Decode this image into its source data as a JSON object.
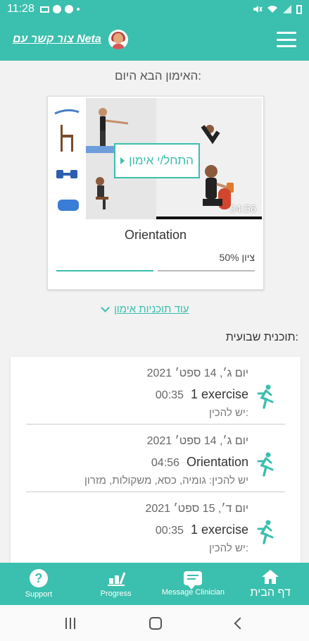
{
  "status_bar": {
    "time": "11:28"
  },
  "header": {
    "contact_link": "צור קשר עם Neta",
    "menu_icon": "hamburger-menu-icon"
  },
  "next_workout": {
    "section_title": "האימון הבא היום:",
    "start_label": "התחל/י אימון",
    "duration": "04:56",
    "name": "Orientation",
    "progress_label": "50% ציון",
    "progress_fraction": 0.5
  },
  "more_plans": {
    "label": "עוד תוכניות אימון"
  },
  "weekly": {
    "title": "תוכנית שבועית:",
    "sessions": [
      {
        "date": "יום ג׳, 14 ספט׳ 2021",
        "name": "1 exercise",
        "time": "00:35",
        "prep": "יש להכין:"
      },
      {
        "date": "יום ג׳, 14 ספט׳ 2021",
        "name": "Orientation",
        "time": "04:56",
        "prep": "יש להכין: גומיה, כסא, משקולות, מזרון"
      },
      {
        "date": "יום ד׳, 15 ספט׳ 2021",
        "name": "1 exercise",
        "time": "00:35",
        "prep": "יש להכין:"
      }
    ]
  },
  "bottom_nav": {
    "support": "Support",
    "progress": "Progress",
    "message": "Message Clinician",
    "home": "דף הבית"
  },
  "colors": {
    "accent": "#3bbfae"
  }
}
